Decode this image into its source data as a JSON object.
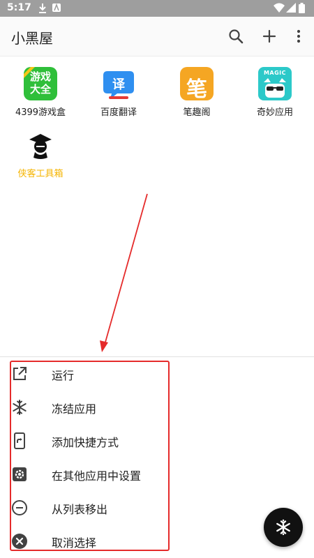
{
  "status_bar": {
    "time": "5:17",
    "icons": [
      "download-icon",
      "app-notification-icon",
      "wifi-icon",
      "signal-icon",
      "battery-icon"
    ]
  },
  "app_bar": {
    "title": "小黑屋",
    "actions": [
      "search-icon",
      "add-icon",
      "more-vert-icon"
    ]
  },
  "apps": [
    {
      "label": "4399游戏盒",
      "icon_text_1": "游戏",
      "icon_text_2": "大全",
      "icon_color": "#2fbf3a"
    },
    {
      "label": "百度翻译",
      "icon_text": "译",
      "icon_color": "#2f8ff0"
    },
    {
      "label": "笔趣阁",
      "icon_text": "笔",
      "icon_color": "#f5a623"
    },
    {
      "label": "奇妙应用",
      "icon_text": "MAGIC",
      "icon_color": "#2cc9c9"
    },
    {
      "label": "侠客工具箱",
      "icon_color": "#111111",
      "label_color": "#f5b400"
    }
  ],
  "menu": {
    "items": [
      {
        "label": "运行",
        "icon": "open-in-new-icon"
      },
      {
        "label": "冻结应用",
        "icon": "snowflake-icon"
      },
      {
        "label": "添加快捷方式",
        "icon": "shortcut-icon"
      },
      {
        "label": "在其他应用中设置",
        "icon": "settings-gear-icon"
      },
      {
        "label": "从列表移出",
        "icon": "remove-circle-icon"
      },
      {
        "label": "取消选择",
        "icon": "cancel-circle-icon"
      }
    ]
  },
  "fab": {
    "icon": "snowflake-icon"
  },
  "colors": {
    "status_bar": "#9e9e9e",
    "highlight_border": "#e52b2b",
    "annotation_arrow": "#e52b2b",
    "fab": "#111111",
    "accent_label": "#f5b400"
  }
}
